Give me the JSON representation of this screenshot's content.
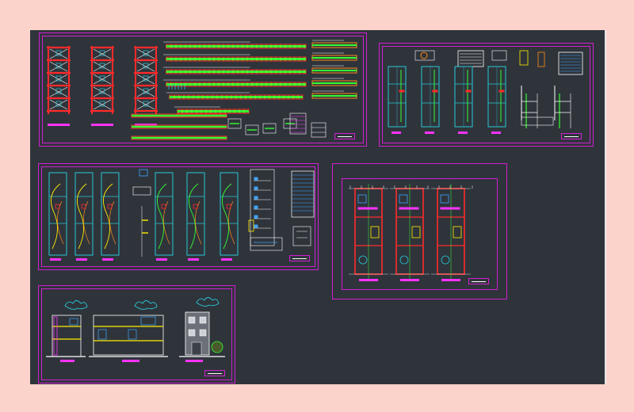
{
  "canvas": {
    "background": "#2f343b",
    "page_background": "#fcd3cb"
  },
  "colors": {
    "frame": "#d21ed2",
    "red": "#ff2a2a",
    "green": "#33ff33",
    "cyan": "#27c8d6",
    "yellow": "#ffee00",
    "white": "#ffffff",
    "magenta": "#ff33ff",
    "orange": "#ff8c1a",
    "blue": "#3da5ff"
  },
  "sheets": [
    {
      "id": "structural-details-sheet"
    },
    {
      "id": "plumbing-sheet"
    },
    {
      "id": "electrical-sheet"
    },
    {
      "id": "architecture-floor-plans-sheet"
    },
    {
      "id": "elevations-sections-sheet"
    }
  ]
}
